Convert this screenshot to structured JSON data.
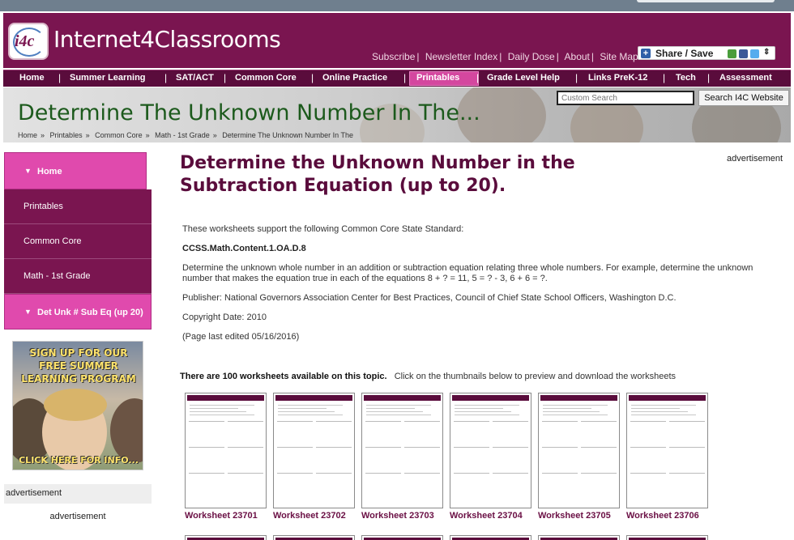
{
  "brand": {
    "name": "Internet4Classrooms",
    "badge": "i4c"
  },
  "toplinks": [
    "Subscribe",
    "Newsletter Index",
    "Daily Dose",
    "About",
    "Site Map"
  ],
  "share": {
    "label": "Share / Save"
  },
  "nav": [
    "Home",
    "Summer Learning",
    "SAT/ACT",
    "Common Core",
    "Online Practice",
    "Printables",
    "Grade Level Help",
    "Links PreK-12",
    "Tech",
    "Assessment"
  ],
  "nav_active": "Printables",
  "banner": {
    "title": "Determine The Unknown Number In The...",
    "search_placeholder": "Custom Search",
    "search_button": "Search I4C Website",
    "breadcrumb": [
      "Home",
      "Printables",
      "Common Core",
      "Math - 1st Grade",
      "Determine The Unknown Number In The"
    ]
  },
  "sidebar": {
    "items": [
      "Home",
      "Printables",
      "Common Core",
      "Math - 1st Grade",
      "Det Unk # Sub Eq (up 20)"
    ],
    "promo": {
      "line1": "SIGN UP FOR OUR",
      "line2": "FREE SUMMER",
      "line3": "LEARNING PROGRAM",
      "cta": "CLICK HERE FOR INFO..."
    },
    "ad1": "advertisement",
    "ad2": "advertisement"
  },
  "main": {
    "title": "Determine the Unknown Number in the Subtraction Equation (up to 20).",
    "ad": "advertisement",
    "intro": "These worksheets support the following Common Core State Standard:",
    "standard": "CCSS.Math.Content.1.OA.D.8",
    "description": "Determine the unknown whole number in an addition or subtraction equation relating three whole numbers. For example, determine the unknown number that makes the equation true in each of the equations 8 + ? = 11, 5 = ? - 3, 6 + 6 = ?.",
    "publisher": "Publisher: National Governors Association Center for Best Practices, Council of Chief State School Officers, Washington D.C.",
    "copyright": "Copyright Date: 2010",
    "edited": "(Page last edited 05/16/2016)",
    "count_bold": "There are 100 worksheets available on this topic.",
    "count_rest": "Click on the thumbnails below to preview and download the worksheets",
    "worksheets": [
      "Worksheet 23701",
      "Worksheet 23702",
      "Worksheet 23703",
      "Worksheet 23704",
      "Worksheet 23705",
      "Worksheet 23706"
    ]
  }
}
